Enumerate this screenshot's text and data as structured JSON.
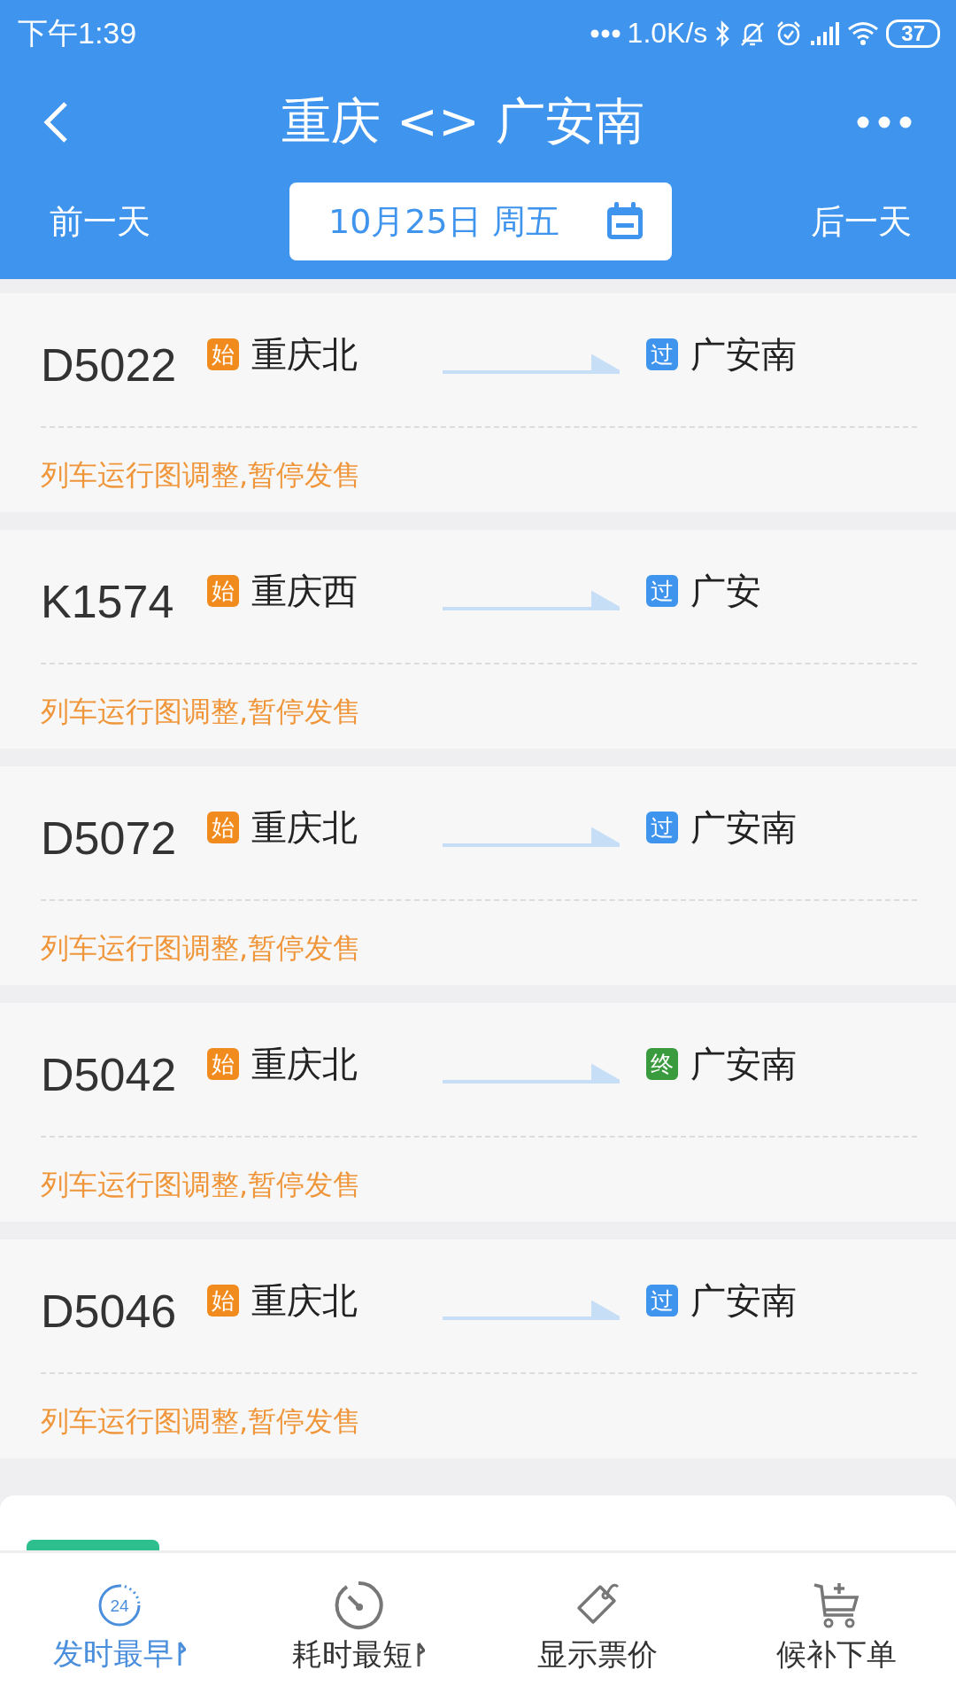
{
  "status_bar": {
    "time": "下午1:39",
    "net_speed": "1.0K/s",
    "battery": "37"
  },
  "header": {
    "title": "重庆 <> 广安南",
    "prev_day": "前一天",
    "date": "10月25日 周五",
    "next_day": "后一天"
  },
  "trains": [
    {
      "number": "D5022",
      "from": "重庆北",
      "from_tag": {
        "text": "始",
        "color": "#f28b1e"
      },
      "to": "广安南",
      "to_tag": {
        "text": "过",
        "color": "#3f94ee"
      },
      "notice": "列车运行图调整,暂停发售"
    },
    {
      "number": "K1574",
      "from": "重庆西",
      "from_tag": {
        "text": "始",
        "color": "#f28b1e"
      },
      "to": "广安",
      "to_tag": {
        "text": "过",
        "color": "#3f94ee"
      },
      "notice": "列车运行图调整,暂停发售"
    },
    {
      "number": "D5072",
      "from": "重庆北",
      "from_tag": {
        "text": "始",
        "color": "#f28b1e"
      },
      "to": "广安南",
      "to_tag": {
        "text": "过",
        "color": "#3f94ee"
      },
      "notice": "列车运行图调整,暂停发售"
    },
    {
      "number": "D5042",
      "from": "重庆北",
      "from_tag": {
        "text": "始",
        "color": "#f28b1e"
      },
      "to": "广安南",
      "to_tag": {
        "text": "终",
        "color": "#3a9b3e"
      },
      "notice": "列车运行图调整,暂停发售"
    },
    {
      "number": "D5046",
      "from": "重庆北",
      "from_tag": {
        "text": "始",
        "color": "#f28b1e"
      },
      "to": "广安南",
      "to_tag": {
        "text": "过",
        "color": "#3f94ee"
      },
      "notice": "列车运行图调整,暂停发售"
    }
  ],
  "bottom_nav": [
    {
      "label": "发时最早",
      "kind": "clock",
      "icon_text": "24",
      "sortable": true,
      "selected": true
    },
    {
      "label": "耗时最短",
      "kind": "timer",
      "sortable": true,
      "selected": false
    },
    {
      "label": "显示票价",
      "kind": "tag",
      "sortable": false,
      "selected": false
    },
    {
      "label": "候补下单",
      "kind": "cart",
      "sortable": false,
      "selected": false
    }
  ]
}
